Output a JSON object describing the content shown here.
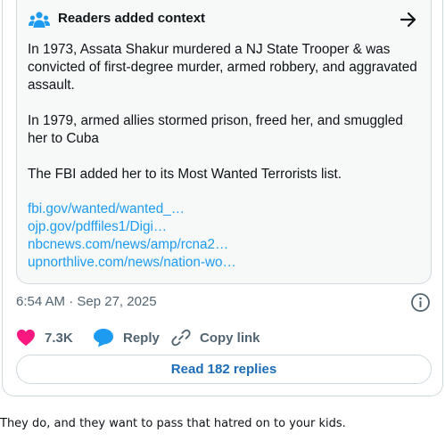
{
  "context": {
    "title": "Readers added context",
    "paragraphs": [
      "In 1973, Assata Shakur murdered a NJ State Trooper & was convicted of first-degree murder, armed robbery, and aggravated assault.",
      "In 1979, armed allies stormed prison, freed her, and smuggled her to Cuba",
      "The FBI added her to its Most Wanted Terrorists list."
    ],
    "links": [
      "fbi.gov/wanted/wanted_…",
      "ojp.gov/pdffiles1/Digi…",
      "nbcnews.com/news/amp/rcna2…",
      "upnorthlive.com/news/nation-wo…"
    ]
  },
  "post": {
    "timestamp": "6:54 AM · Sep 27, 2025",
    "like_count": "7.3K",
    "reply_label": "Reply",
    "copy_link_label": "Copy link",
    "read_replies_label": "Read 182 replies"
  },
  "comment": {
    "text": "They do, and they want to pass that hatred on to your kids."
  },
  "colors": {
    "like": "#f91880",
    "reply": "#1d9bf0",
    "link": "#1d9bf0",
    "accent_icon": "#1d9bf0"
  },
  "icons": [
    "people-icon",
    "arrow-right-icon",
    "info-icon",
    "heart-icon",
    "reply-bubble-icon",
    "link-icon"
  ]
}
